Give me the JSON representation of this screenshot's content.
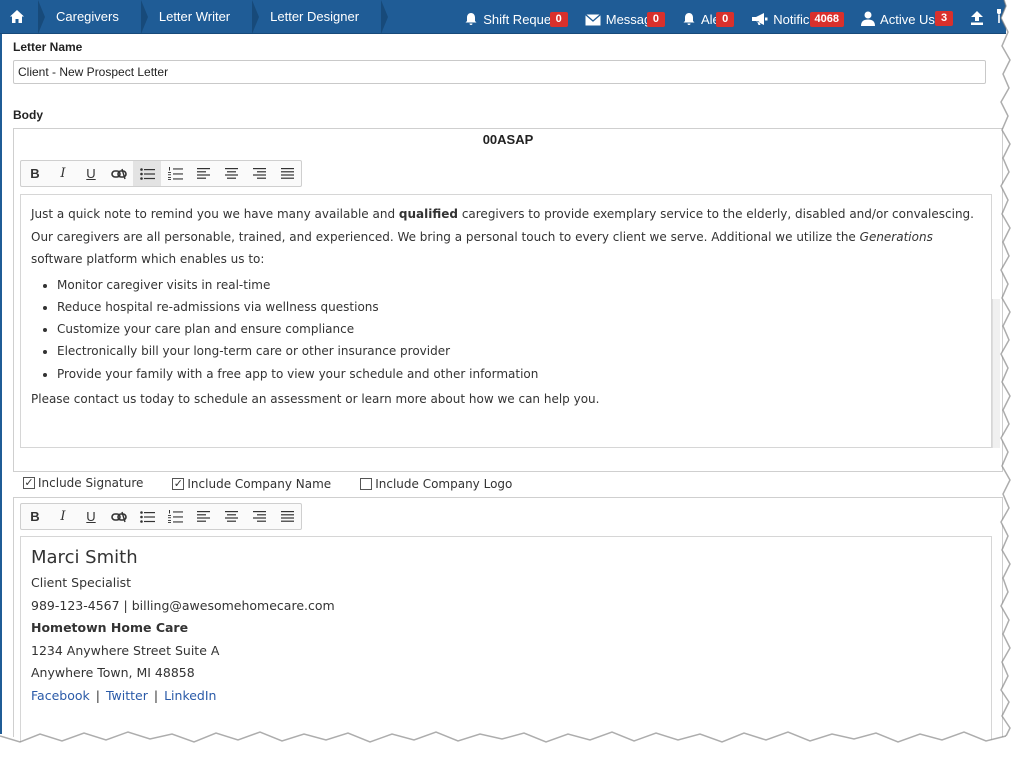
{
  "nav": {
    "breadcrumbs": [
      "Caregivers",
      "Letter Writer",
      "Letter Designer"
    ],
    "items": [
      {
        "label": "Shift Requests",
        "badge": "0",
        "icon": "bell-icon"
      },
      {
        "label": "Messages",
        "badge": "0",
        "icon": "envelope-icon"
      },
      {
        "label": "Alerts",
        "badge": "0",
        "icon": "bell-icon"
      },
      {
        "label": "Notifications",
        "badge": "4068",
        "icon": "megaphone-icon"
      },
      {
        "label": "Active Users",
        "badge": "3",
        "icon": "user-icon"
      }
    ],
    "colors": {
      "bar": "#1f5c96",
      "badge": "#d9302c"
    }
  },
  "form": {
    "letter_name_label": "Letter Name",
    "letter_name_value": "Client - New Prospect Letter",
    "body_label": "Body",
    "body_title": "00ASAP"
  },
  "toolbar": {
    "bold": "B",
    "italic": "I",
    "underline": "U"
  },
  "body": {
    "p1_a": "Just a quick note to remind you we have many available and ",
    "p1_bold": "qualified",
    "p1_b": " caregivers to provide exemplary service to the elderly, disabled and/or convalescing. Our caregivers are all personable, trained, and experienced. We bring a personal touch to every client we serve. Additional we utilize the ",
    "p1_italic": "Generations",
    "p1_c": " software platform which enables us to:",
    "bullets": [
      "Monitor caregiver visits in real-time",
      "Reduce hospital re-admissions via wellness questions",
      "Customize your care plan and ensure compliance",
      "Electronically bill your long-term care or other insurance provider",
      "Provide your family with a free app to view your schedule and other information"
    ],
    "closing": "Please contact us today to schedule an assessment or learn more about how we can help you."
  },
  "options": {
    "include_signature": {
      "label": "Include Signature",
      "checked": true
    },
    "include_company_name": {
      "label": "Include Company Name",
      "checked": true
    },
    "include_company_logo": {
      "label": "Include Company Logo",
      "checked": false
    }
  },
  "signature": {
    "name": "Marci Smith",
    "title": "Client Specialist",
    "contact": "989-123-4567 | billing@awesomehomecare.com",
    "company": "Hometown Home Care",
    "address1": "1234 Anywhere Street Suite A",
    "address2": "Anywhere Town, MI 48858",
    "links": [
      "Facebook",
      "Twitter",
      "LinkedIn"
    ]
  }
}
